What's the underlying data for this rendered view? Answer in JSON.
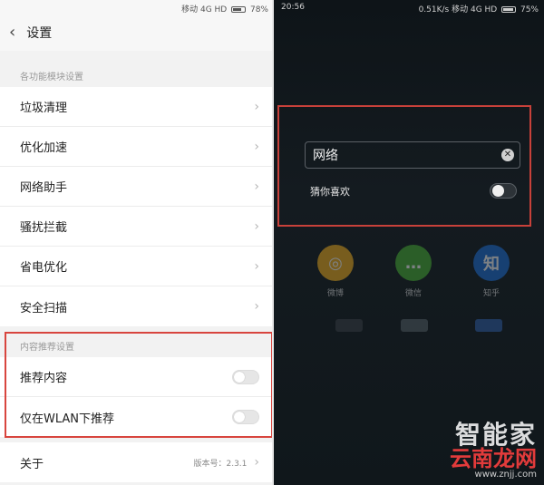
{
  "left": {
    "status": {
      "carrier": "移动 4G HD",
      "battery": "78%"
    },
    "header": {
      "title": "设置"
    },
    "section1": {
      "title": "各功能模块设置",
      "items": [
        {
          "label": "垃圾清理"
        },
        {
          "label": "优化加速"
        },
        {
          "label": "网络助手"
        },
        {
          "label": "骚扰拦截"
        },
        {
          "label": "省电优化"
        },
        {
          "label": "安全扫描"
        }
      ]
    },
    "section2": {
      "title": "内容推荐设置",
      "items": [
        {
          "label": "推荐内容",
          "enabled": false
        },
        {
          "label": "仅在WLAN下推荐",
          "enabled": false
        }
      ]
    },
    "about": {
      "label": "关于",
      "version": "版本号：2.3.1"
    }
  },
  "right": {
    "status": {
      "time": "20:56",
      "speed": "0.51K/s",
      "carrier": "移动 4G HD",
      "battery": "75%"
    },
    "search": {
      "value": "网络"
    },
    "guess": {
      "label": "猜你喜欢",
      "enabled": false
    },
    "apps": [
      {
        "label": "微博",
        "glyph": "◎",
        "color": "#f2b01e"
      },
      {
        "label": "微信",
        "glyph": "…",
        "color": "#49b233"
      },
      {
        "label": "知乎",
        "glyph": "知",
        "color": "#1e6fd8"
      }
    ]
  },
  "watermark": {
    "line1": "智能家",
    "line2": "云南龙网",
    "url": "www.znjj.com"
  },
  "colors": {
    "highlight": "#d8453e",
    "dark_bg": "#10171b"
  }
}
